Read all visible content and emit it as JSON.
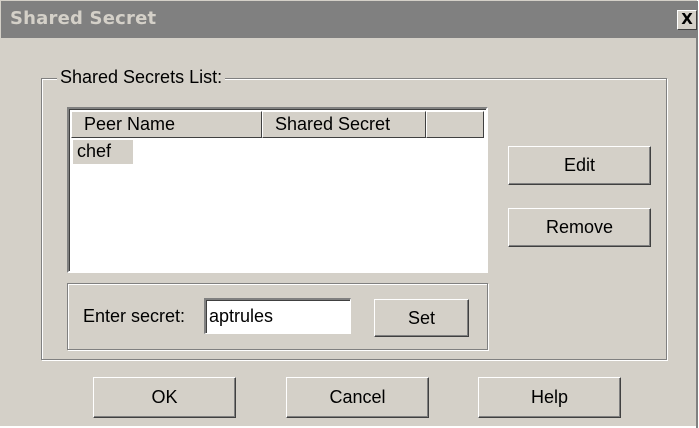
{
  "window": {
    "title": "Shared Secret",
    "close_label": "X"
  },
  "group": {
    "label": "Shared Secrets List:"
  },
  "list": {
    "columns": [
      "Peer Name",
      "Shared Secret",
      ""
    ],
    "rows": [
      {
        "peer_name": "chef",
        "shared_secret": ""
      }
    ]
  },
  "side_buttons": {
    "edit": "Edit",
    "remove": "Remove"
  },
  "secret_entry": {
    "label": "Enter secret:",
    "value": "aptrules",
    "set_label": "Set"
  },
  "dialog_buttons": {
    "ok": "OK",
    "cancel": "Cancel",
    "help": "Help"
  },
  "colors": {
    "face": "#d4d0c8",
    "titlebar": "#808080",
    "title_text": "#d4d0c8"
  }
}
